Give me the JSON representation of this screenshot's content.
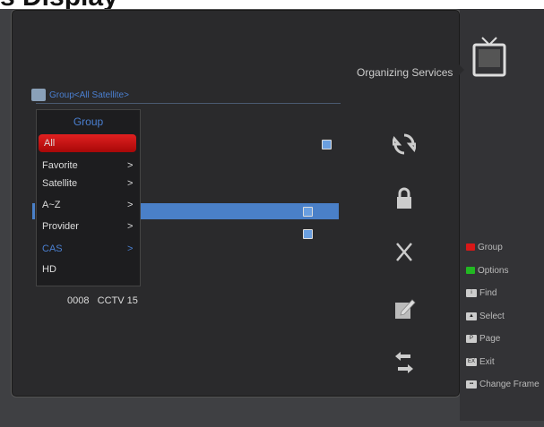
{
  "colors": {
    "accent_red": "#d81818",
    "accent_blue": "#4a7fd0",
    "green": "#22b822"
  },
  "top_text": "s  Display",
  "title": "Organizing Services",
  "header": {
    "text": "Group<All Satellite>",
    "icon": "satellite-icon"
  },
  "group_menu": {
    "title": "Group",
    "items": [
      {
        "label": "All",
        "arrow": "",
        "active": true
      },
      {
        "label": "Favorite",
        "arrow": ">"
      },
      {
        "label": "Satellite",
        "arrow": ">"
      },
      {
        "label": "A~Z",
        "arrow": ">"
      },
      {
        "label": "Provider",
        "arrow": ">"
      },
      {
        "label": "CAS",
        "arrow": ">"
      },
      {
        "label": "HD",
        "arrow": ""
      }
    ]
  },
  "channel": {
    "number": "0008",
    "name": "CCTV 15"
  },
  "actions": [
    "move-icon",
    "lock-icon",
    "delete-icon",
    "rename-icon",
    "back-icon"
  ],
  "legend": [
    {
      "label": "Group",
      "icon": "red-key"
    },
    {
      "label": "Options",
      "icon": "green-key"
    },
    {
      "label": "Find",
      "icon": "find-key"
    },
    {
      "label": "Select",
      "icon": "ok-key"
    },
    {
      "label": "Page",
      "icon": "page-key"
    },
    {
      "label": "Exit",
      "icon": "exit-key"
    },
    {
      "label": "Change Frame",
      "icon": "frame-key"
    }
  ]
}
